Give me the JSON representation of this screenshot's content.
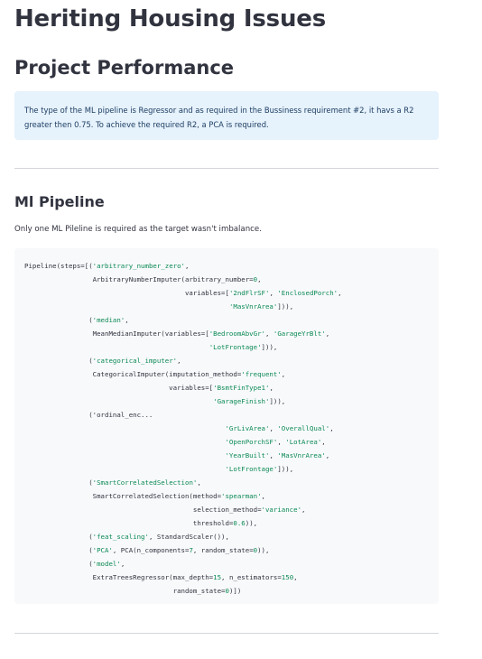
{
  "app": {
    "title": "Heriting Housing Issues"
  },
  "page": {
    "section_title": "Project Performance",
    "info_text": "The type of the ML pipeline is Regressor and as required in the Bussiness requirement #2, it havs a R2 greater then 0.75. To achieve the required R2, a PCA is required.",
    "pipeline_title": "Ml Pipeline",
    "pipeline_caption": "Only one ML Pileline is required as the target wasn't imbalance."
  },
  "code": {
    "lines": [
      [
        [
          "p",
          "Pipeline(steps=[("
        ],
        [
          "s",
          "'arbitrary_number_zero'"
        ],
        [
          "p",
          ","
        ]
      ],
      [
        [
          "p",
          "                 ArbitraryNumberImputer(arbitrary_number="
        ],
        [
          "n",
          "0"
        ],
        [
          "p",
          ","
        ]
      ],
      [
        [
          "p",
          "                                        variables=["
        ],
        [
          "s",
          "'2ndFlrSF'"
        ],
        [
          "p",
          ", "
        ],
        [
          "s",
          "'EnclosedPorch'"
        ],
        [
          "p",
          ","
        ]
      ],
      [
        [
          "p",
          "                                                   "
        ],
        [
          "s",
          "'MasVnrArea'"
        ],
        [
          "p",
          "])),"
        ]
      ],
      [
        [
          "p",
          "                ("
        ],
        [
          "s",
          "'median'"
        ],
        [
          "p",
          ","
        ]
      ],
      [
        [
          "p",
          "                 MeanMedianImputer(variables=["
        ],
        [
          "s",
          "'BedroomAbvGr'"
        ],
        [
          "p",
          ", "
        ],
        [
          "s",
          "'GarageYrBlt'"
        ],
        [
          "p",
          ","
        ]
      ],
      [
        [
          "p",
          "                                              "
        ],
        [
          "s",
          "'LotFrontage'"
        ],
        [
          "p",
          "])),"
        ]
      ],
      [
        [
          "p",
          "                ("
        ],
        [
          "s",
          "'categorical_imputer'"
        ],
        [
          "p",
          ","
        ]
      ],
      [
        [
          "p",
          "                 CategoricalImputer(imputation_method="
        ],
        [
          "s",
          "'frequent'"
        ],
        [
          "p",
          ","
        ]
      ],
      [
        [
          "p",
          "                                    variables=["
        ],
        [
          "s",
          "'BsmtFinType1'"
        ],
        [
          "p",
          ","
        ]
      ],
      [
        [
          "p",
          "                                               "
        ],
        [
          "s",
          "'GarageFinish'"
        ],
        [
          "p",
          "])),"
        ]
      ],
      [
        [
          "p",
          "                ('ordinal_enc..."
        ]
      ],
      [
        [
          "p",
          "                                                  "
        ],
        [
          "s",
          "'GrLivArea'"
        ],
        [
          "p",
          ", "
        ],
        [
          "s",
          "'OverallQual'"
        ],
        [
          "p",
          ","
        ]
      ],
      [
        [
          "p",
          "                                                  "
        ],
        [
          "s",
          "'OpenPorchSF'"
        ],
        [
          "p",
          ", "
        ],
        [
          "s",
          "'LotArea'"
        ],
        [
          "p",
          ","
        ]
      ],
      [
        [
          "p",
          "                                                  "
        ],
        [
          "s",
          "'YearBuilt'"
        ],
        [
          "p",
          ", "
        ],
        [
          "s",
          "'MasVnrArea'"
        ],
        [
          "p",
          ","
        ]
      ],
      [
        [
          "p",
          "                                                  "
        ],
        [
          "s",
          "'LotFrontage'"
        ],
        [
          "p",
          "])),"
        ]
      ],
      [
        [
          "p",
          "                ("
        ],
        [
          "s",
          "'SmartCorrelatedSelection'"
        ],
        [
          "p",
          ","
        ]
      ],
      [
        [
          "p",
          "                 SmartCorrelatedSelection(method="
        ],
        [
          "s",
          "'spearman'"
        ],
        [
          "p",
          ","
        ]
      ],
      [
        [
          "p",
          "                                          selection_method="
        ],
        [
          "s",
          "'variance'"
        ],
        [
          "p",
          ","
        ]
      ],
      [
        [
          "p",
          "                                          threshold="
        ],
        [
          "n",
          "0.6"
        ],
        [
          "p",
          ")),"
        ]
      ],
      [
        [
          "p",
          "                ("
        ],
        [
          "s",
          "'feat_scaling'"
        ],
        [
          "p",
          ", StandardScaler()),"
        ]
      ],
      [
        [
          "p",
          "                ("
        ],
        [
          "s",
          "'PCA'"
        ],
        [
          "p",
          ", PCA(n_components="
        ],
        [
          "n",
          "7"
        ],
        [
          "p",
          ", random_state="
        ],
        [
          "n",
          "0"
        ],
        [
          "p",
          ")),"
        ]
      ],
      [
        [
          "p",
          "                ("
        ],
        [
          "s",
          "'model'"
        ],
        [
          "p",
          ","
        ]
      ],
      [
        [
          "p",
          "                 ExtraTreesRegressor(max_depth="
        ],
        [
          "n",
          "15"
        ],
        [
          "p",
          ", n_estimators="
        ],
        [
          "n",
          "150"
        ],
        [
          "p",
          ","
        ]
      ],
      [
        [
          "p",
          "                                     random_state="
        ],
        [
          "n",
          "0"
        ],
        [
          "p",
          ")])"
        ]
      ]
    ]
  },
  "colors": {
    "info_bg": "#e6f2fc",
    "info_text": "#1d3e63",
    "code_bg": "#f8f9fb",
    "code_string": "#0b8a55",
    "text": "#31333f"
  }
}
